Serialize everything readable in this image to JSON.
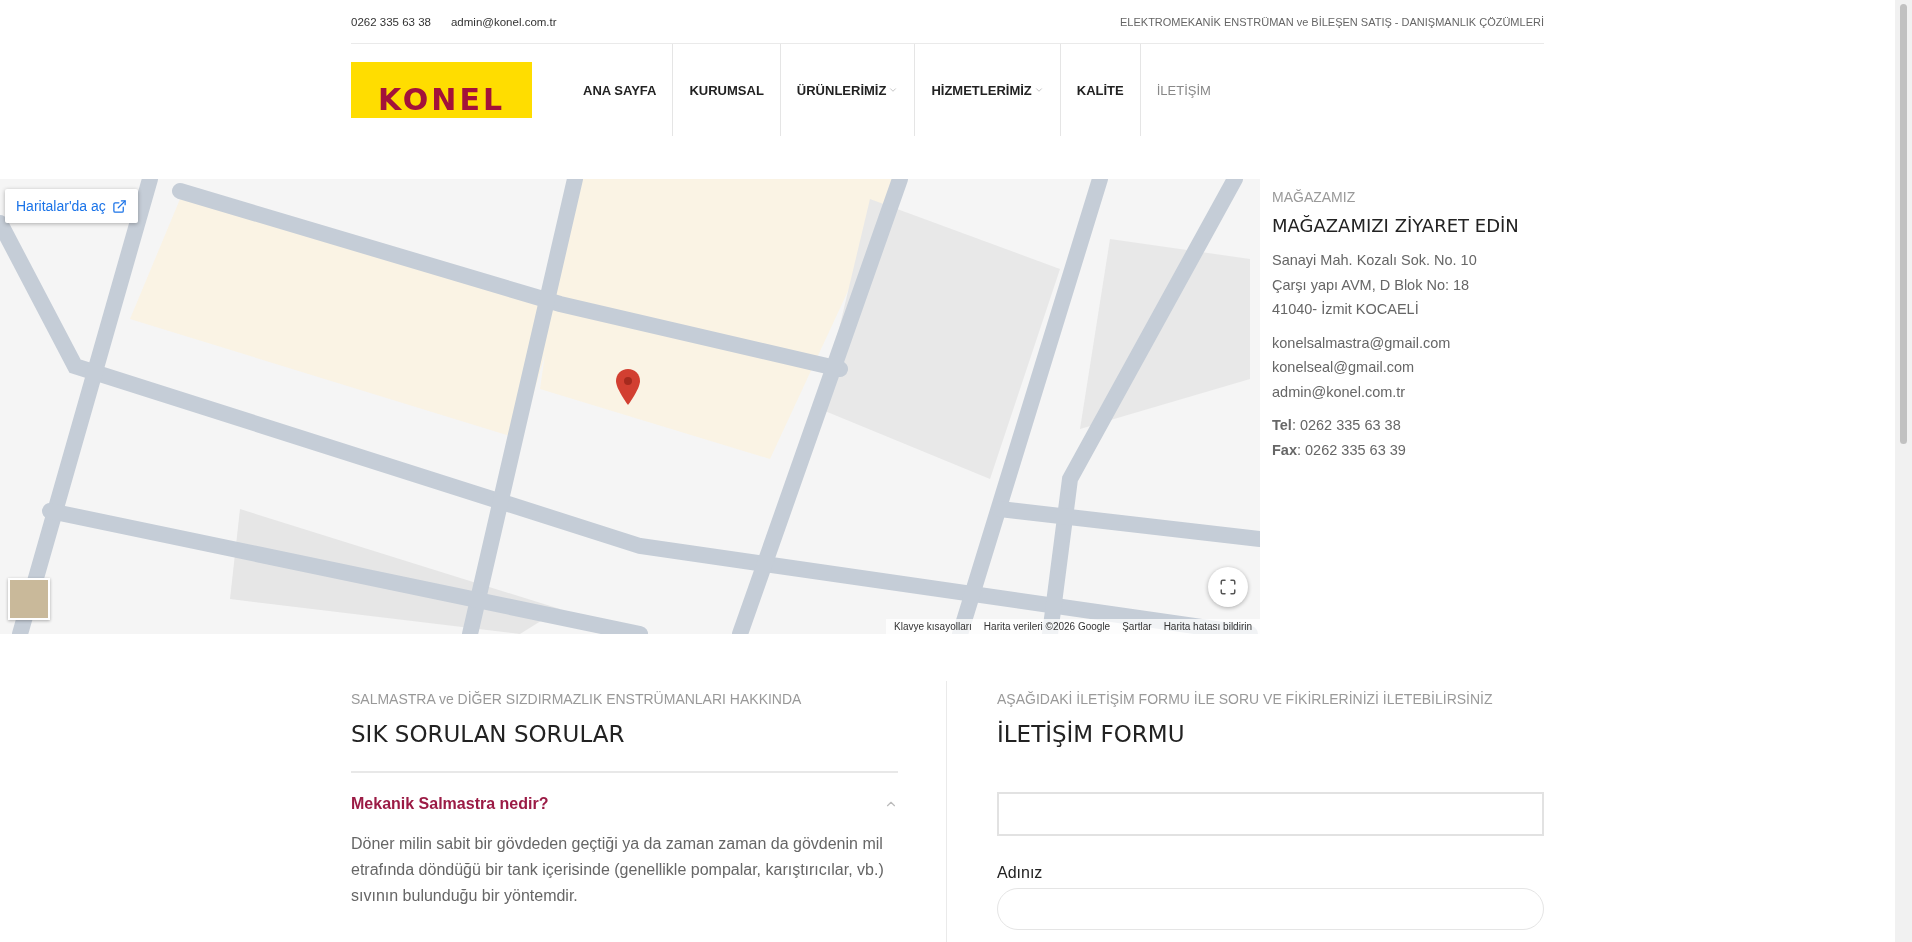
{
  "topbar": {
    "phone": "0262 335 63 38",
    "email": "admin@konel.com.tr",
    "tagline": "ELEKTROMEKANİK ENSTRÜMAN ve BİLEŞEN SATIŞ - DANIŞMANLIK ÇÖZÜMLERİ"
  },
  "logo": {
    "text": "KONEL"
  },
  "nav": [
    {
      "label": "ANA SAYFA",
      "selected": false,
      "dropdown": false
    },
    {
      "label": "KURUMSAL",
      "selected": false,
      "dropdown": false
    },
    {
      "label": "ÜRÜNLERİMİZ",
      "selected": false,
      "dropdown": true
    },
    {
      "label": "HİZMETLERİMİZ",
      "selected": false,
      "dropdown": true
    },
    {
      "label": "KALİTE",
      "selected": false,
      "dropdown": false
    },
    {
      "label": "İLETİŞİM",
      "selected": true,
      "dropdown": false
    }
  ],
  "map": {
    "open_button": "Haritalar'da aç",
    "footer_links": [
      "Klavye kısayolları",
      "Harita verileri ©2026 Google",
      "Şartlar",
      "Harita hatası bildirin"
    ]
  },
  "store": {
    "eyebrow": "MAĞAZAMIZ",
    "title": "MAĞAZAMIZI ZİYARET EDİN",
    "address": [
      "Sanayi Mah. Kozalı Sok. No. 10",
      "Çarşı yapı AVM, D Blok No: 18",
      "41040- İzmit KOCAELİ"
    ],
    "emails": [
      "konelsalmastra@gmail.com",
      "konelseal@gmail.com",
      "admin@konel.com.tr"
    ],
    "phones": [
      "**Tel**: 0262 335 63 38",
      "**Fax**: 0262 335 63 39"
    ]
  },
  "faq": {
    "eyebrow": "SALMASTRA ve DİĞER SIZDIRMAZLIK ENSTRÜMANLARI HAKKINDA",
    "title": "SIK SORULAN SORULAR",
    "items": [
      {
        "question": "Mekanik Salmastra nedir?",
        "expanded": true,
        "answer": "Döner milin sabit bir gövdeden geçtiği ya da zaman zaman da gövdenin mil etrafında döndüğü bir tank içerisinde (genellikle pompalar, karıştırıcılar, vb.) sıvının bulunduğu bir yöntemdir."
      }
    ]
  },
  "form": {
    "eyebrow": "AŞAĞIDAKİ İLETİŞİM FORMU İLE SORU VE FİKİRLERİNİZİ İLETEBİLİRSİNİZ",
    "title": "İLETİŞİM FORMU",
    "fields": [
      {
        "kind": "square"
      },
      {
        "kind": "rounded",
        "label": "Adınız"
      }
    ]
  }
}
